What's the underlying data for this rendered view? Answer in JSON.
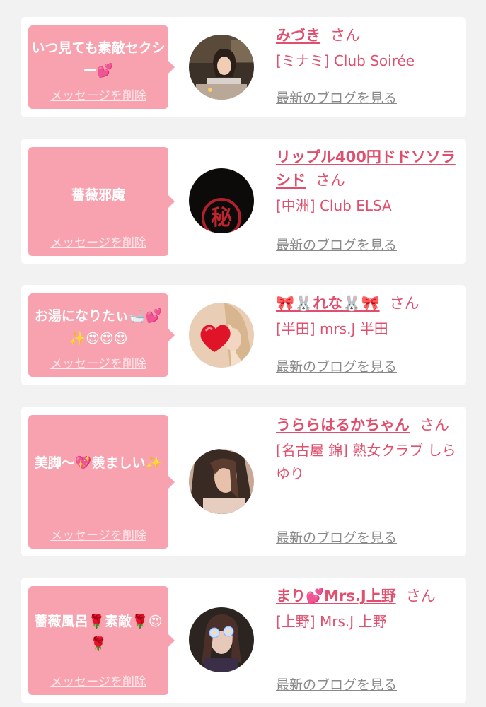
{
  "colors": {
    "accent": "#e0506e",
    "bubble": "#f7a2ae",
    "link_gray": "#8a8a8a",
    "background": "#f2f2f2"
  },
  "cards": [
    {
      "message": "いつ見ても素敵セクシー💕",
      "delete_label": "メッセージを削除",
      "name": "みづき",
      "honorific": "さん",
      "shop": "[ミナミ] Club Soirée",
      "blog_link": "最新のブログを見る",
      "avatar": "cast-photo-icon"
    },
    {
      "message": "薔薇邪魔",
      "delete_label": "メッセージを削除",
      "name": "リップル400円ドドソソラシド",
      "honorific": "さん",
      "shop": "[中洲] Club ELSA",
      "blog_link": "最新のブログを見る",
      "avatar": "secret-mark-icon"
    },
    {
      "message": "お湯になりたぃ🛁💕✨😍😍😍",
      "delete_label": "メッセージを削除",
      "name": "🎀🐰れな🐰🎀",
      "honorific": "さん",
      "shop": "[半田] mrs.J 半田",
      "blog_link": "最新のブログを見る",
      "avatar": "heart-covered-photo-icon"
    },
    {
      "message": "美脚〜💖羨ましい✨",
      "delete_label": "メッセージを削除",
      "name": "うららはるかちゃん",
      "honorific": "さん",
      "shop": "[名古屋 錦] 熟女クラブ しらゆり",
      "blog_link": "最新のブログを見る",
      "avatar": "cast-photo-icon"
    },
    {
      "message": "薔薇風呂🌹素敵🌹😍🌹",
      "delete_label": "メッセージを削除",
      "name": "まり💕Mrs.J上野",
      "honorific": "さん",
      "shop": "[上野] Mrs.J 上野",
      "blog_link": "最新のブログを見る",
      "avatar": "flower-covered-photo-icon"
    }
  ]
}
